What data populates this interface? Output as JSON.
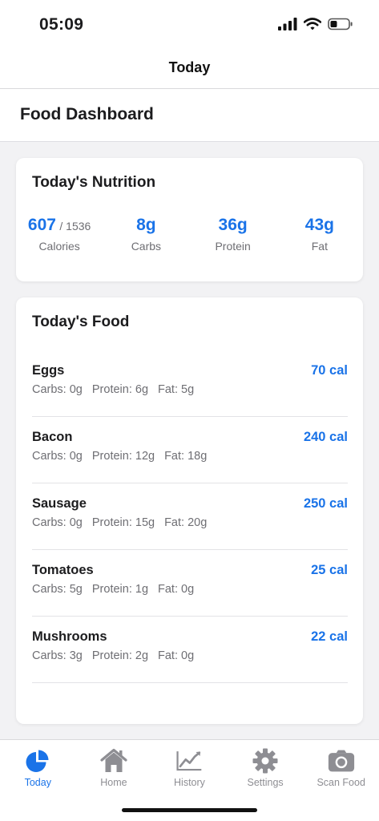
{
  "status_bar": {
    "time": "05:09"
  },
  "nav": {
    "title": "Today"
  },
  "header": {
    "title": "Food Dashboard"
  },
  "nutrition": {
    "title": "Today's Nutrition",
    "stats": [
      {
        "value": "607",
        "goal": "/ 1536",
        "label": "Calories"
      },
      {
        "value": "8g",
        "goal": "",
        "label": "Carbs"
      },
      {
        "value": "36g",
        "goal": "",
        "label": "Protein"
      },
      {
        "value": "43g",
        "goal": "",
        "label": "Fat"
      }
    ]
  },
  "food": {
    "title": "Today's Food",
    "items": [
      {
        "name": "Eggs",
        "calories": "70 cal",
        "carbs": "Carbs: 0g",
        "protein": "Protein: 6g",
        "fat": "Fat: 5g"
      },
      {
        "name": "Bacon",
        "calories": "240 cal",
        "carbs": "Carbs: 0g",
        "protein": "Protein: 12g",
        "fat": "Fat: 18g"
      },
      {
        "name": "Sausage",
        "calories": "250 cal",
        "carbs": "Carbs: 0g",
        "protein": "Protein: 15g",
        "fat": "Fat: 20g"
      },
      {
        "name": "Tomatoes",
        "calories": "25 cal",
        "carbs": "Carbs: 5g",
        "protein": "Protein: 1g",
        "fat": "Fat: 0g"
      },
      {
        "name": "Mushrooms",
        "calories": "22 cal",
        "carbs": "Carbs: 3g",
        "protein": "Protein: 2g",
        "fat": "Fat: 0g"
      }
    ]
  },
  "tabs": [
    {
      "label": "Today",
      "icon": "pie-chart-icon",
      "active": true
    },
    {
      "label": "Home",
      "icon": "home-icon",
      "active": false
    },
    {
      "label": "History",
      "icon": "line-chart-icon",
      "active": false
    },
    {
      "label": "Settings",
      "icon": "gear-icon",
      "active": false
    },
    {
      "label": "Scan Food",
      "icon": "camera-icon",
      "active": false
    }
  ],
  "colors": {
    "accent": "#1a73e8",
    "muted": "#8e8e93",
    "background": "#f2f2f4"
  }
}
